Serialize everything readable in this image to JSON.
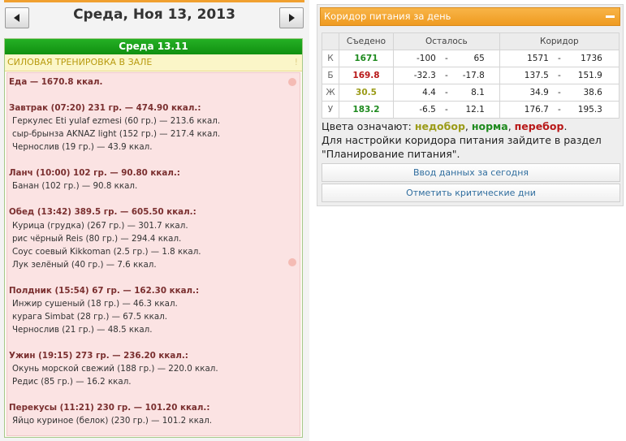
{
  "nav": {
    "date_title": "Среда, Ноя 13, 2013",
    "prev_icon": "left-triangle-icon",
    "next_icon": "right-triangle-icon"
  },
  "day": {
    "header": "Среда 13.11",
    "training": "СИЛОВАЯ ТРЕНИРОВКА В ЗАЛЕ",
    "training_mark": "!",
    "food_total": "Еда — 1670.8 ккал.",
    "meals": [
      {
        "title": "Завтрак (07:20) 231 гр. — 474.90 ккал.:",
        "items": [
          "Геркулес Eti yulaf ezmesi (60 гр.) — 213.6 ккал.",
          "сыр-брынза AKNAZ light (152 гр.) — 217.4 ккал.",
          "Чернослив (19 гр.) — 43.9 ккал."
        ]
      },
      {
        "title": "Ланч (10:00) 102 гр. — 90.80 ккал.:",
        "items": [
          "Банан (102 гр.) — 90.8 ккал."
        ]
      },
      {
        "title": "Обед (13:42) 389.5 гр. — 605.50 ккал.:",
        "items": [
          "Курица (грудка) (267 гр.) — 301.7 ккал.",
          "рис чёрный Reis (80 гр.) — 294.4 ккал.",
          "Соус соевый Kikkoman (2.5 гр.) — 1.8 ккал.",
          "Лук зелёный (40 гр.) — 7.6 ккал."
        ]
      },
      {
        "title": "Полдник (15:54) 67 гр. — 162.30 ккал.:",
        "items": [
          "Инжир сушеный (18 гр.) — 46.3 ккал.",
          "курага Simbat (28 гр.) — 67.5 ккал.",
          "Чернослив (21 гр.) — 48.5 ккал."
        ]
      },
      {
        "title": "Ужин (19:15) 273 гр. — 236.20 ккал.:",
        "items": [
          "Окунь морской свежий (188 гр.) — 220.0 ккал.",
          "Редис (85 гр.) — 16.2 ккал."
        ]
      },
      {
        "title": "Перекусы (11:21) 230 гр. — 101.20 ккал.:",
        "items": [
          "Яйцо куриное (белок) (230 гр.) — 101.2 ккал."
        ]
      }
    ]
  },
  "corridor": {
    "title": "Коридор питания за день",
    "collapse_icon": "minus-icon",
    "headers": [
      "",
      "Съедено",
      "Осталось",
      "Коридор"
    ],
    "dash": "-",
    "rows": [
      {
        "label": "К",
        "eaten": "1671",
        "eaten_status": "norm",
        "left_min": "-100",
        "left_max": "65",
        "corr_min": "1571",
        "corr_max": "1736"
      },
      {
        "label": "Б",
        "eaten": "169.8",
        "eaten_status": "over",
        "left_min": "-32.3",
        "left_max": "-17.8",
        "corr_min": "137.5",
        "corr_max": "151.9"
      },
      {
        "label": "Ж",
        "eaten": "30.5",
        "eaten_status": "under",
        "left_min": "4.4",
        "left_max": "8.1",
        "corr_min": "34.9",
        "corr_max": "38.6"
      },
      {
        "label": "У",
        "eaten": "183.2",
        "eaten_status": "norm",
        "left_min": "-6.5",
        "left_max": "12.1",
        "corr_min": "176.7",
        "corr_max": "195.3"
      }
    ],
    "status_colors": {
      "under": "#9b9b18",
      "norm": "#1e8a1e",
      "over": "#b81818"
    },
    "legend": {
      "prefix": "Цвета означают: ",
      "under": "недобор",
      "sep1": ", ",
      "norm": "норма",
      "sep2": ", ",
      "over": "перебор",
      "end": ".",
      "line2": "Для настройки коридора питания зайдите в раздел",
      "line3": "\"Планирование питания\"."
    },
    "buttons": {
      "enter_data": "Ввод данных за сегодня",
      "critical_days": "Отметить критические дни"
    }
  }
}
